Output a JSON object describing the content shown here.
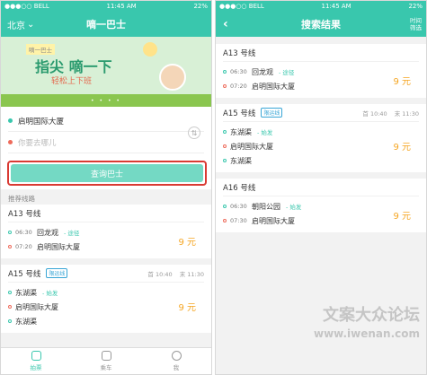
{
  "status_bar": {
    "carrier": "●●●○○ BELL",
    "time": "11:45 AM",
    "battery": "22%"
  },
  "left": {
    "city": "北京",
    "title": "嘀一巴士",
    "banner": {
      "tag": "嘀一巴士",
      "headline": "指尖 嘀一下",
      "subline": "轻松上下班",
      "dots": "• • • •"
    },
    "from_value": "启明国际大厦",
    "to_placeholder": "你要去哪儿",
    "swap_icon": "swap-icon",
    "query_label": "查询巴士",
    "section_label": "推荐线路",
    "routes": [
      {
        "name": "A13 号线",
        "stops": [
          {
            "time": "06:30",
            "name": "回龙观",
            "note": "- 途径"
          },
          {
            "time": "07:20",
            "name": "启明国际大厦",
            "note": ""
          }
        ],
        "price": "9 元"
      },
      {
        "name": "A15 号线",
        "badge": "限运线",
        "first": "首 10:40",
        "last": "末 11:30",
        "stops": [
          {
            "time": "",
            "name": "东湖渠",
            "note": "- 始发"
          },
          {
            "time": "",
            "name": "启明国际大厦",
            "note": ""
          },
          {
            "time": "",
            "name": "东湖渠",
            "note": ""
          }
        ],
        "price": "9 元"
      }
    ],
    "tabs": [
      {
        "label": "拍票"
      },
      {
        "label": "乘车"
      },
      {
        "label": "我"
      }
    ]
  },
  "right": {
    "title": "搜索结果",
    "time_filter": [
      "时间",
      "筛选"
    ],
    "routes": [
      {
        "name": "A13 号线",
        "stops": [
          {
            "time": "06:30",
            "name": "回龙观",
            "note": "- 途径"
          },
          {
            "time": "07:20",
            "name": "启明国际大厦",
            "note": ""
          }
        ],
        "price": "9 元"
      },
      {
        "name": "A15 号线",
        "badge": "限运线",
        "first": "首 10:40",
        "last": "末 11:30",
        "stops": [
          {
            "time": "",
            "name": "东湖渠",
            "note": "- 始发"
          },
          {
            "time": "",
            "name": "启明国际大厦",
            "note": ""
          },
          {
            "time": "",
            "name": "东湖渠",
            "note": ""
          }
        ],
        "price": "9 元"
      },
      {
        "name": "A16 号线",
        "stops": [
          {
            "time": "06:30",
            "name": "朝阳公园",
            "note": "- 始发"
          },
          {
            "time": "07:30",
            "name": "启明国际大厦",
            "note": ""
          }
        ],
        "price": "9 元"
      }
    ]
  },
  "watermark": {
    "line1": "文案大众论坛",
    "line2": "www.iwenan.com"
  },
  "colors": {
    "accent": "#39c7ad",
    "price": "#f5a623",
    "highlight": "#d93a33"
  }
}
